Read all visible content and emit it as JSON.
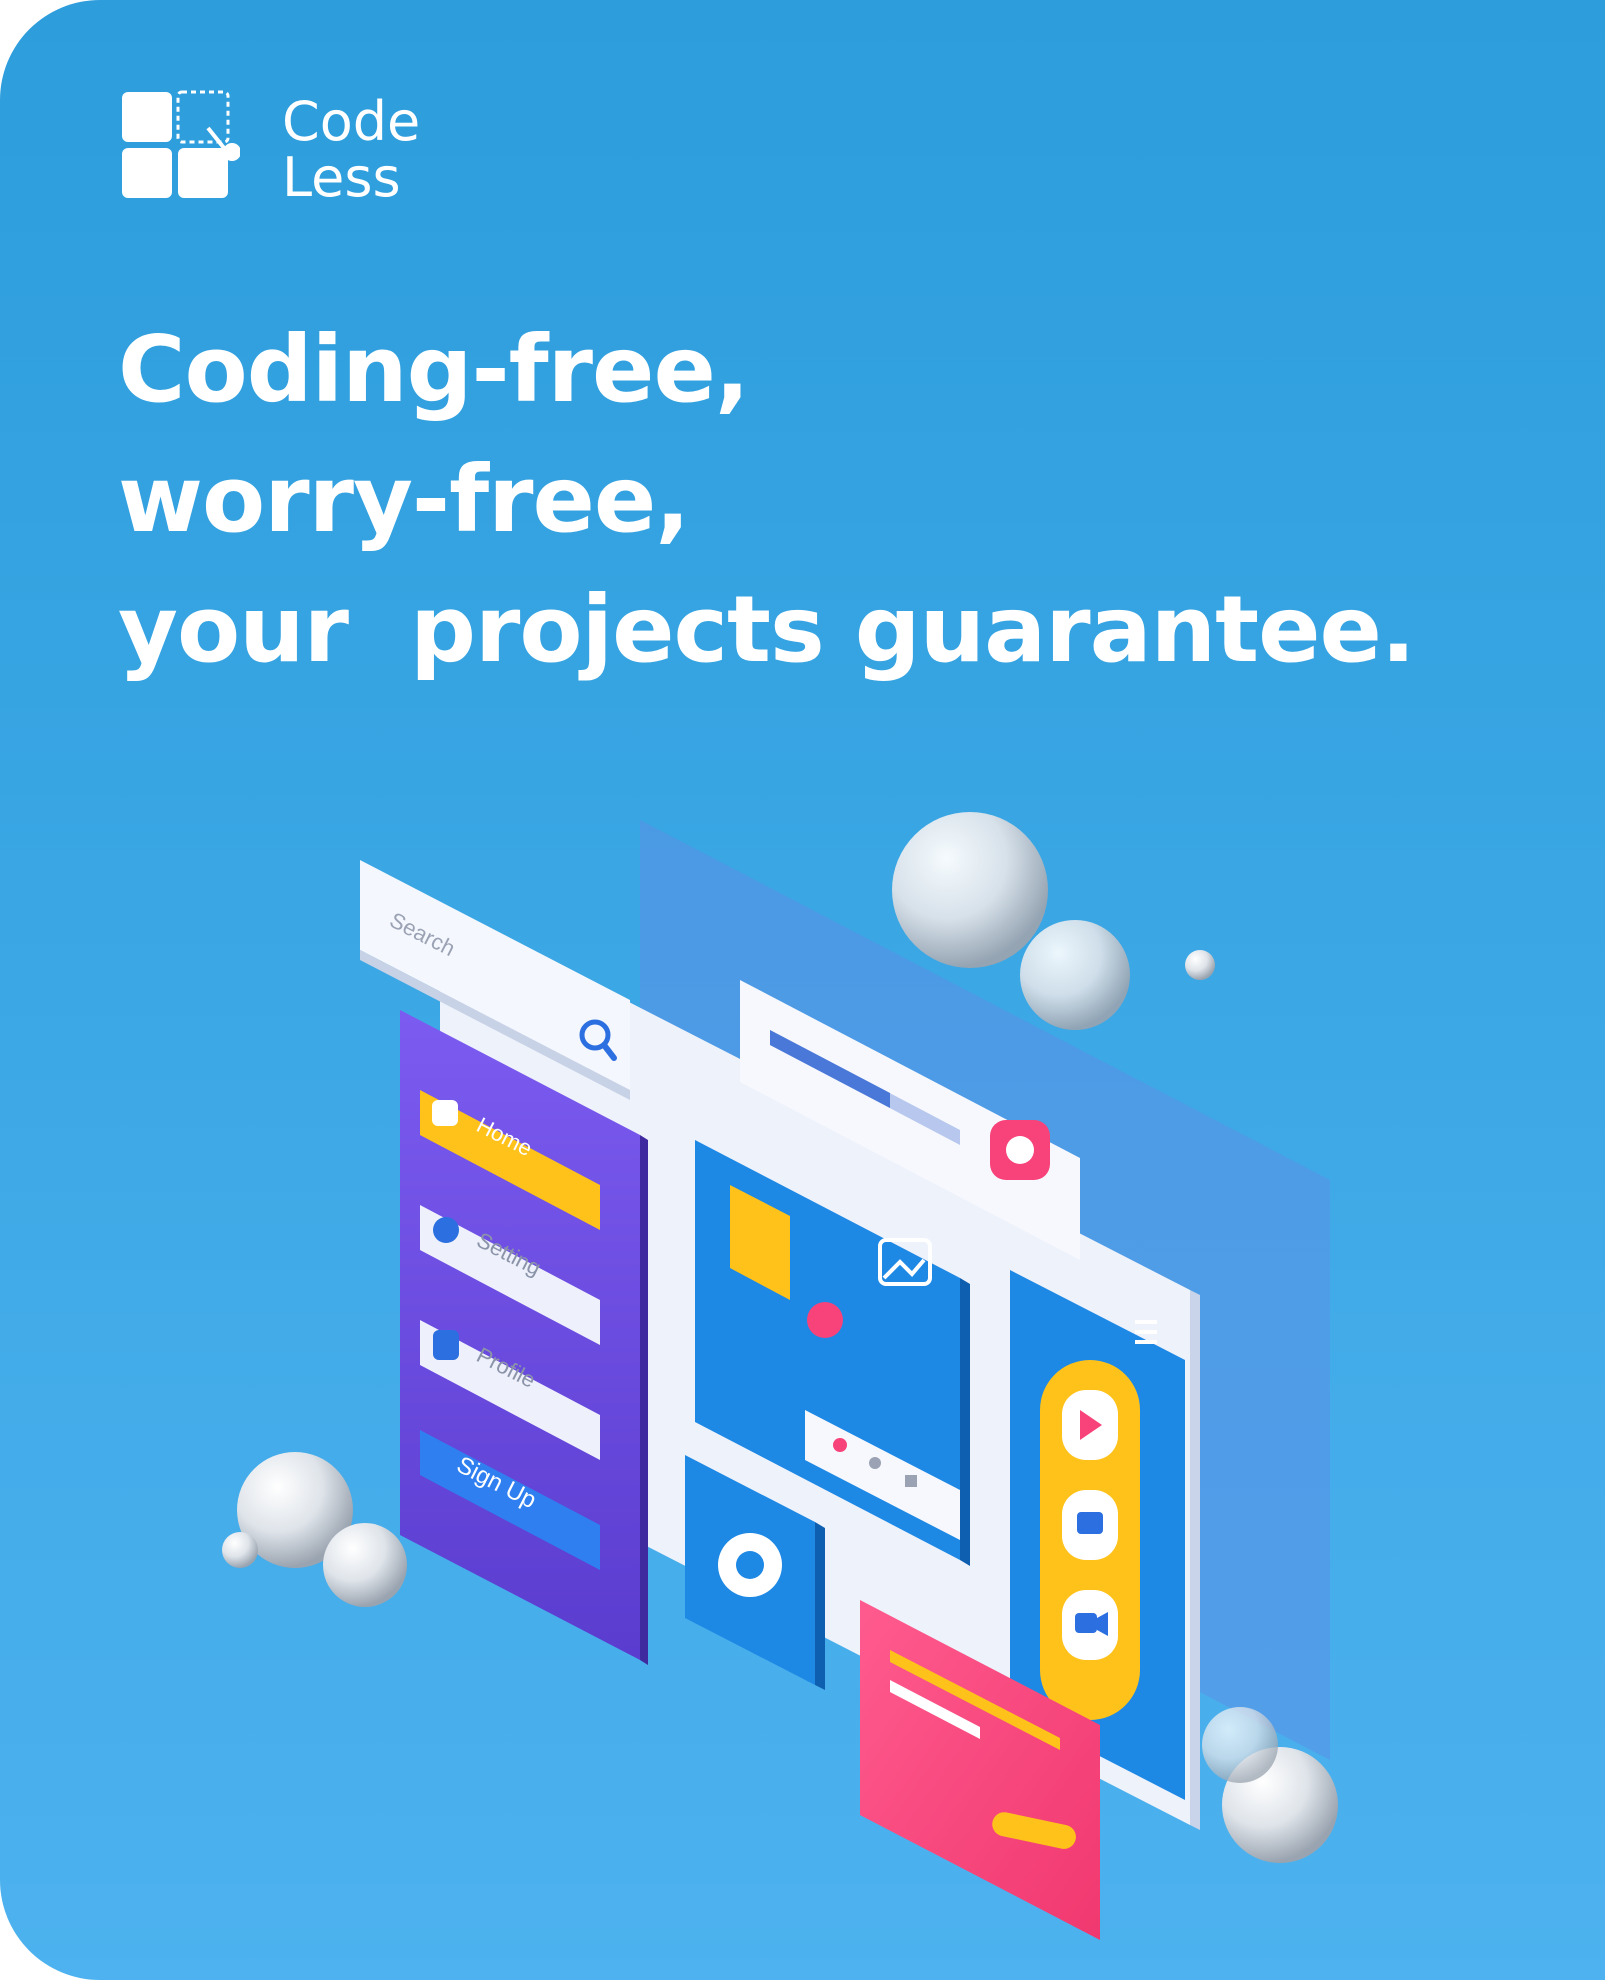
{
  "logo": {
    "line1": "Code",
    "line2": "Less"
  },
  "headline": {
    "line1": "Coding-free,",
    "line2": "worry-free,",
    "line3": "your  projects guarantee."
  },
  "illustration": {
    "search_placeholder": "Search",
    "menu": {
      "home": "Home",
      "setting": "Setting",
      "profile": "Profile",
      "sign_up": "Sign Up"
    },
    "icons": [
      "search-icon",
      "home-icon",
      "gear-icon",
      "user-icon",
      "image-icon",
      "cloud-download-icon",
      "hamburger-icon",
      "play-icon",
      "camera-icon",
      "video-icon",
      "heart-icon",
      "share-icon",
      "download-icon"
    ]
  },
  "colors": {
    "background_top": "#2d9ddc",
    "background_bottom": "#4db2ef",
    "purple_panel": "#6a4de0",
    "yellow": "#ffc21a",
    "pink": "#f8427a",
    "blue": "#1e88e5"
  }
}
